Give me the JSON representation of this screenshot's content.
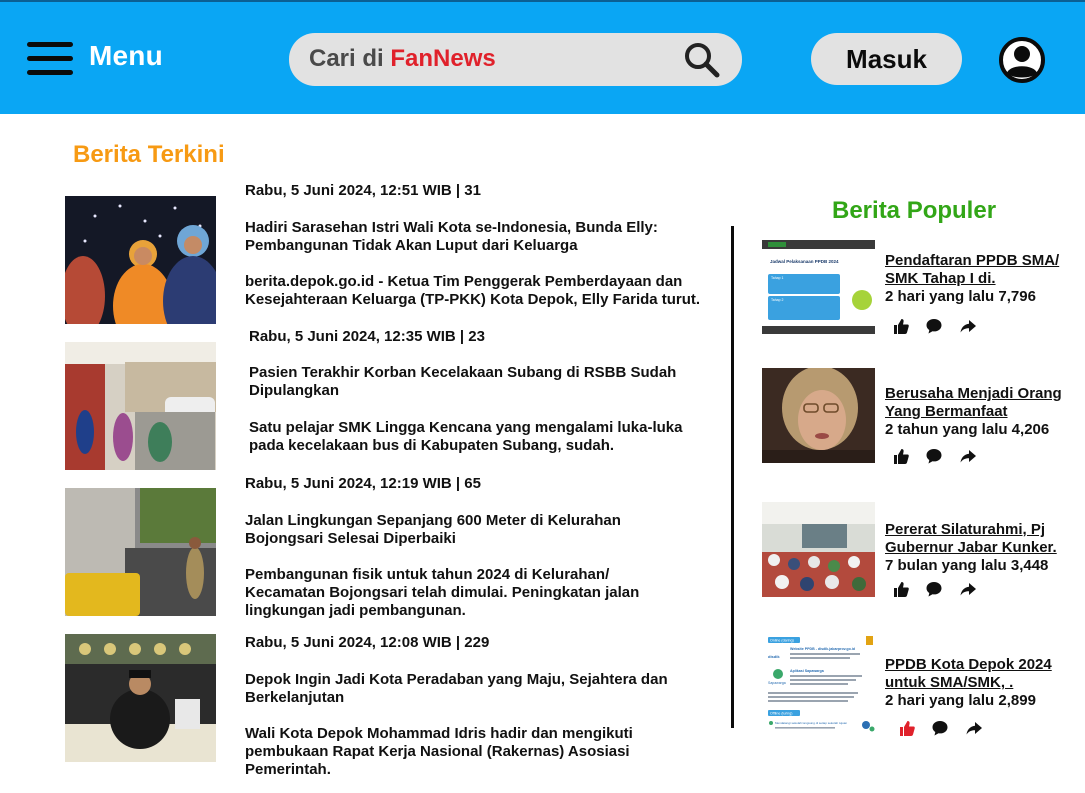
{
  "header": {
    "menu_label": "Menu",
    "search_prefix": "Cari di ",
    "search_brand_1": "Fan",
    "search_brand_2": "News",
    "login_label": "Masuk",
    "accent_color": "#0aa6f4"
  },
  "terkini": {
    "title": "Berita Terkini",
    "items": [
      {
        "meta": "Rabu, 5 Juni 2024, 12:51 WIB |  31",
        "title_1": "Hadiri Sarasehan Istri Wali Kota se-Indonesia, Bunda Elly:",
        "title_2": "Pembangunan Tidak Akan Luput dari Keluarga",
        "body_1": "berita.depok.go.id - Ketua Tim Penggerak Pemberdayaan dan",
        "body_2": "Kesejahteraan Keluarga (TP-PKK) Kota Depok, Elly Farida turut."
      },
      {
        "meta": "Rabu, 5 Juni 2024, 12:35 WIB |  23",
        "title_1": "Pasien Terakhir Korban Kecelakaan Subang di RSBB Sudah",
        "title_2": "Dipulangkan",
        "body_1": "Satu pelajar SMK Lingga Kencana yang mengalami luka-luka",
        "body_2": "pada kecelakaan bus di Kabupaten Subang, sudah."
      },
      {
        "meta": "Rabu, 5 Juni 2024, 12:19 WIB |  65",
        "title_1": "Jalan Lingkungan Sepanjang 600 Meter di Kelurahan",
        "title_2": "Bojongsari Selesai Diperbaiki",
        "body_1": "Pembangunan fisik untuk tahun 2024 di Kelurahan/",
        "body_2": "Kecamatan Bojongsari telah dimulai. Peningkatan jalan",
        "body_3": "lingkungan jadi pembangunan."
      },
      {
        "meta": "Rabu, 5 Juni 2024, 12:08 WIB |  229",
        "title_1": "Depok Ingin Jadi Kota Peradaban yang Maju, Sejahtera dan",
        "title_2": "Berkelanjutan",
        "body_1": "Wali Kota Depok Mohammad Idris hadir dan mengikuti",
        "body_2": "pembukaan Rapat Kerja Nasional (Rakernas) Asosiasi",
        "body_3": "Pemerintah."
      }
    ]
  },
  "populer": {
    "title": "Berita Populer",
    "items": [
      {
        "title_1": "Pendaftaran PPDB SMA/",
        "title_2": "SMK Tahap I di.",
        "meta": "2 hari yang lalu  7,796",
        "liked": false
      },
      {
        "title_1": "Berusaha Menjadi Orang",
        "title_2": "Yang Bermanfaat",
        "meta": "2 tahun yang lalu  4,206",
        "liked": false
      },
      {
        "title_1": "Pererat Silaturahmi, Pj",
        "title_2": "Gubernur Jabar Kunker.",
        "meta": "7 bulan yang lalu  3,448",
        "liked": false
      },
      {
        "title_1": "PPDB Kota Depok 2024",
        "title_2": "untuk SMA/SMK, .",
        "meta": "2 hari yang lalu  2,899",
        "liked": true
      }
    ],
    "thumb_1": {
      "heading": "Jadwal Pelaksanaan PPDB 2024",
      "tahap": "Tahap 1",
      "tahap_2": "Tahap 2"
    },
    "thumb_4": {
      "badge_1": "Online (daring)",
      "label_1": "Website PPDB - disdik.jabarprov.go.id",
      "label_2": "Aplikasi Sapawarga",
      "badge_2": "Offline (luring)",
      "label_3": "Mendatangi sekolah langsung di setiap sekolah tujuan",
      "logo_1": "disdik",
      "logo_2": "Sapawarga"
    }
  }
}
